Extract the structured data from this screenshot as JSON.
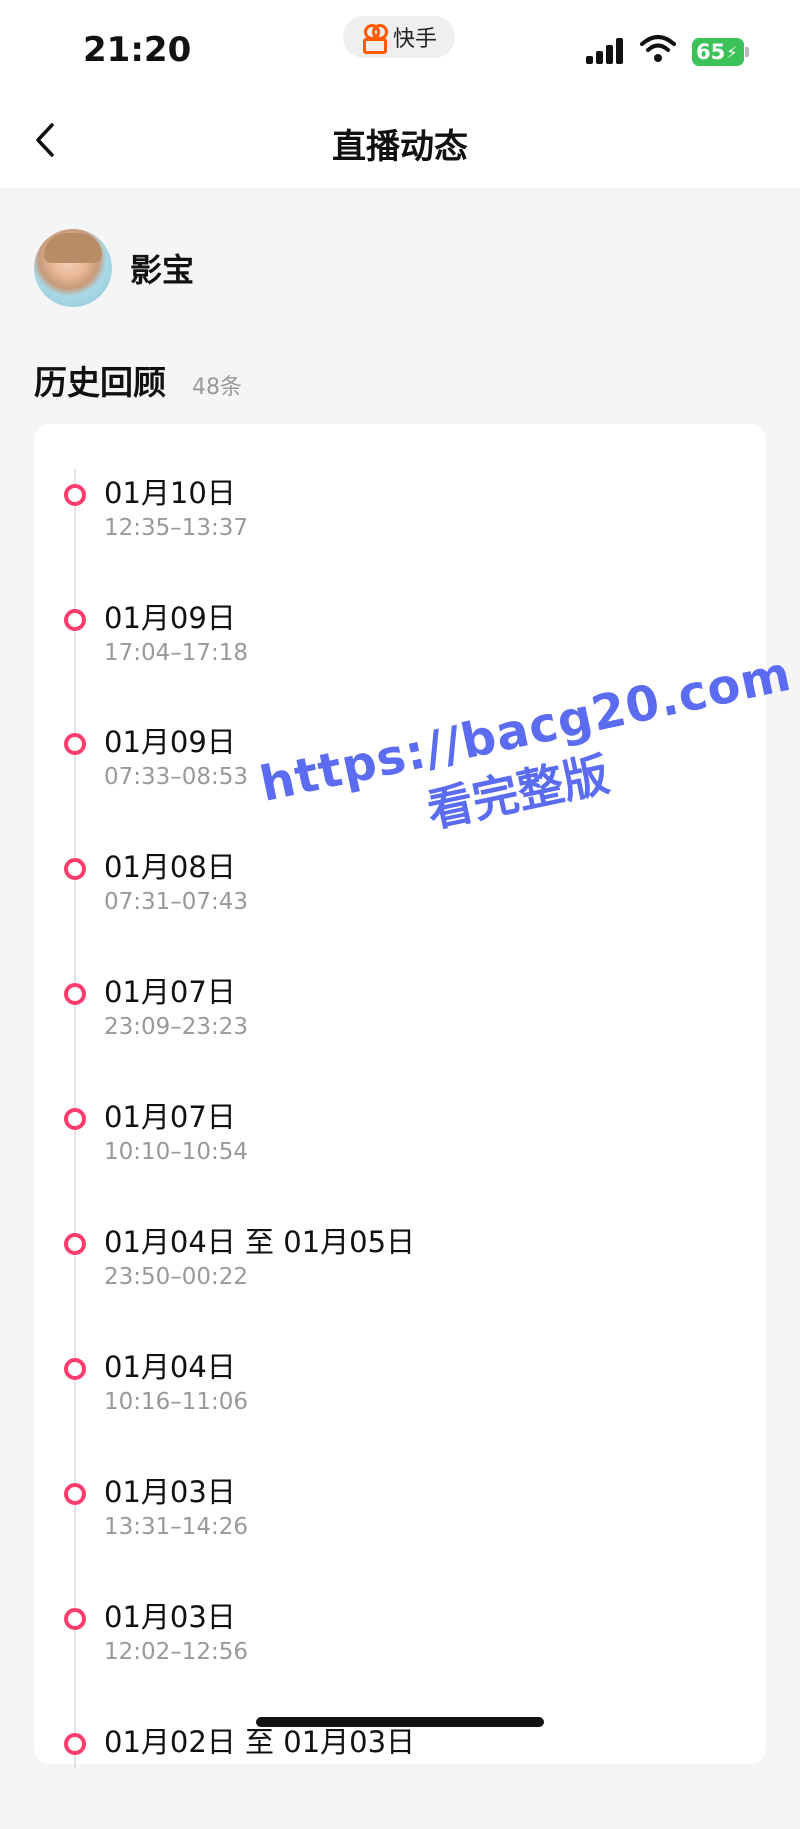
{
  "status_bar": {
    "time": "21:20",
    "app_name": "快手",
    "battery_level": "65",
    "accent_color": "#ff5a00"
  },
  "nav": {
    "title": "直播动态",
    "back_icon": "chevron-left-icon"
  },
  "profile": {
    "username": "影宝"
  },
  "history": {
    "title": "历史回顾",
    "count": "48条",
    "dot_color": "#ff3c6e",
    "entries": [
      {
        "date": "01月10日",
        "time": "12:35–13:37"
      },
      {
        "date": "01月09日",
        "time": "17:04–17:18"
      },
      {
        "date": "01月09日",
        "time": "07:33–08:53"
      },
      {
        "date": "01月08日",
        "time": "07:31–07:43"
      },
      {
        "date": "01月07日",
        "time": "23:09–23:23"
      },
      {
        "date": "01月07日",
        "time": "10:10–10:54"
      },
      {
        "date": "01月04日 至 01月05日",
        "time": "23:50–00:22"
      },
      {
        "date": "01月04日",
        "time": "10:16–11:06"
      },
      {
        "date": "01月03日",
        "time": "13:31–14:26"
      },
      {
        "date": "01月03日",
        "time": "12:02–12:56"
      },
      {
        "date": "01月02日 至 01月03日",
        "time": ""
      }
    ]
  },
  "watermark": {
    "line1": "https://bacg20.com",
    "line2": "看完整版",
    "color": "#5b6cf0"
  }
}
